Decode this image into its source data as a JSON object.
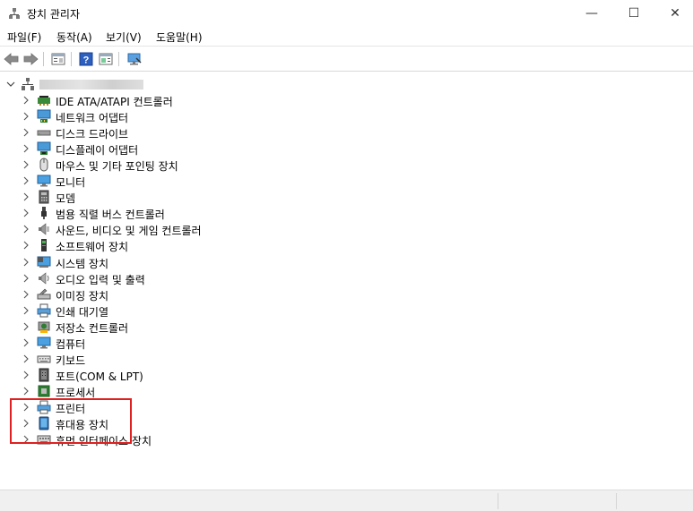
{
  "window": {
    "title": "장치 관리자",
    "minimize_glyph": "—",
    "maximize_glyph": "☐",
    "close_glyph": "✕"
  },
  "menu": [
    {
      "label": "파일(F)"
    },
    {
      "label": "동작(A)"
    },
    {
      "label": "보기(V)"
    },
    {
      "label": "도움말(H)"
    }
  ],
  "toolbar": {
    "buttons": [
      "back-icon",
      "forward-icon",
      "properties-icon",
      "help-icon",
      "action-view-icon",
      "scan-hardware-icon"
    ]
  },
  "tree": {
    "root_label": "",
    "root_expanded": true,
    "categories": [
      {
        "label": "IDE ATA/ATAPI 컨트롤러",
        "icon": "ide-controller-icon"
      },
      {
        "label": "네트워크 어댑터",
        "icon": "network-adapter-icon"
      },
      {
        "label": "디스크 드라이브",
        "icon": "disk-drive-icon"
      },
      {
        "label": "디스플레이 어댑터",
        "icon": "display-adapter-icon"
      },
      {
        "label": "마우스 및 기타 포인팅 장치",
        "icon": "mouse-icon"
      },
      {
        "label": "모니터",
        "icon": "monitor-icon"
      },
      {
        "label": "모뎀",
        "icon": "modem-icon"
      },
      {
        "label": "범용 직렬 버스 컨트롤러",
        "icon": "usb-icon"
      },
      {
        "label": "사운드, 비디오 및 게임 컨트롤러",
        "icon": "sound-icon"
      },
      {
        "label": "소프트웨어 장치",
        "icon": "software-device-icon"
      },
      {
        "label": "시스템 장치",
        "icon": "system-device-icon"
      },
      {
        "label": "오디오 입력 및 출력",
        "icon": "audio-io-icon"
      },
      {
        "label": "이미징 장치",
        "icon": "imaging-device-icon"
      },
      {
        "label": "인쇄 대기열",
        "icon": "print-queue-icon"
      },
      {
        "label": "저장소 컨트롤러",
        "icon": "storage-controller-icon"
      },
      {
        "label": "컴퓨터",
        "icon": "computer-icon"
      },
      {
        "label": "키보드",
        "icon": "keyboard-icon"
      },
      {
        "label": "포트(COM & LPT)",
        "icon": "port-icon"
      },
      {
        "label": "프로세서",
        "icon": "processor-icon"
      },
      {
        "label": "프린터",
        "icon": "printer-icon"
      },
      {
        "label": "휴대용 장치",
        "icon": "portable-device-icon"
      },
      {
        "label": "휴먼 인터페이스 장치",
        "icon": "hid-icon"
      }
    ]
  },
  "colors": {
    "highlight": "#e02020",
    "accent": "#1e73c8"
  }
}
